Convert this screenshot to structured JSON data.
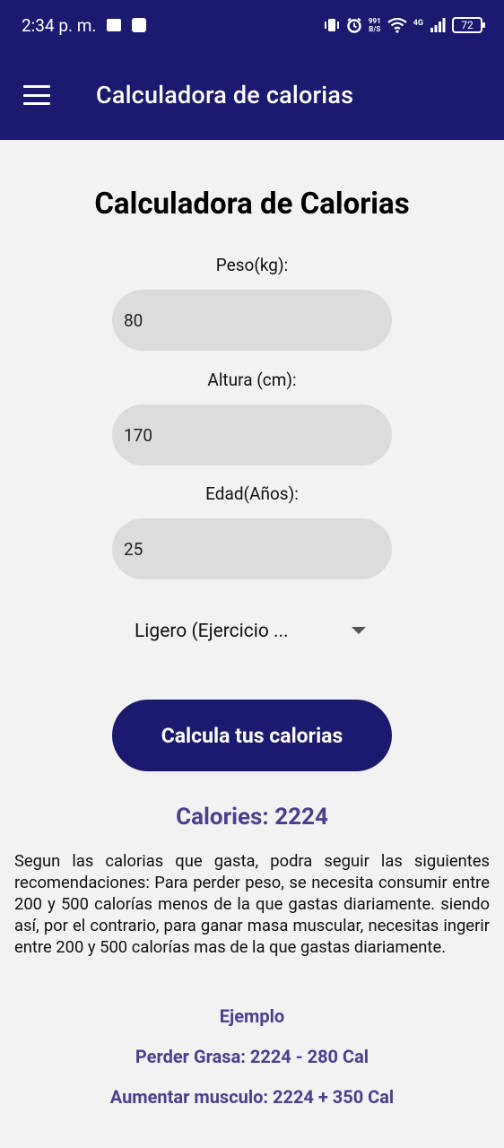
{
  "status_bar": {
    "time": "2:34 p. m.",
    "net_speed_value": "991",
    "net_speed_unit": "B/S",
    "network_type": "4G",
    "battery": "72"
  },
  "app_bar": {
    "title": "Calculadora de calorias",
    "menu_icon": "hamburger-menu-icon",
    "background": "#1b1a6e"
  },
  "form": {
    "heading": "Calculadora de Calorias",
    "weight_label": "Peso(kg):",
    "weight_value": "80",
    "height_label": "Altura (cm):",
    "height_value": "170",
    "age_label": "Edad(Años):",
    "age_value": "25",
    "activity_selected": "Ligero (Ejercicio ...",
    "submit_label": "Calcula tus calorias"
  },
  "result": {
    "calories_text": "Calories: 2224",
    "description": "Segun las calorias que gasta, podra seguir las siguientes recomendaciones: Para perder peso, se necesita consumir entre 200 y 500 calorías menos de la que gastas diariamente. siendo así, por el contrario, para ganar masa muscular, necesitas ingerir entre 200 y 500 calorías mas de la que gastas diariamente.",
    "example_title": "Ejemplo",
    "lose_fat": "Perder Grasa: 2224 - 280 Cal",
    "gain_muscle": "Aumentar musculo: 2224 + 350 Cal"
  },
  "colors": {
    "primary": "#1b1a6e",
    "accent_text": "#4d3f8e",
    "input_bg": "#dcdcdc",
    "page_bg": "#f2f2f2"
  }
}
